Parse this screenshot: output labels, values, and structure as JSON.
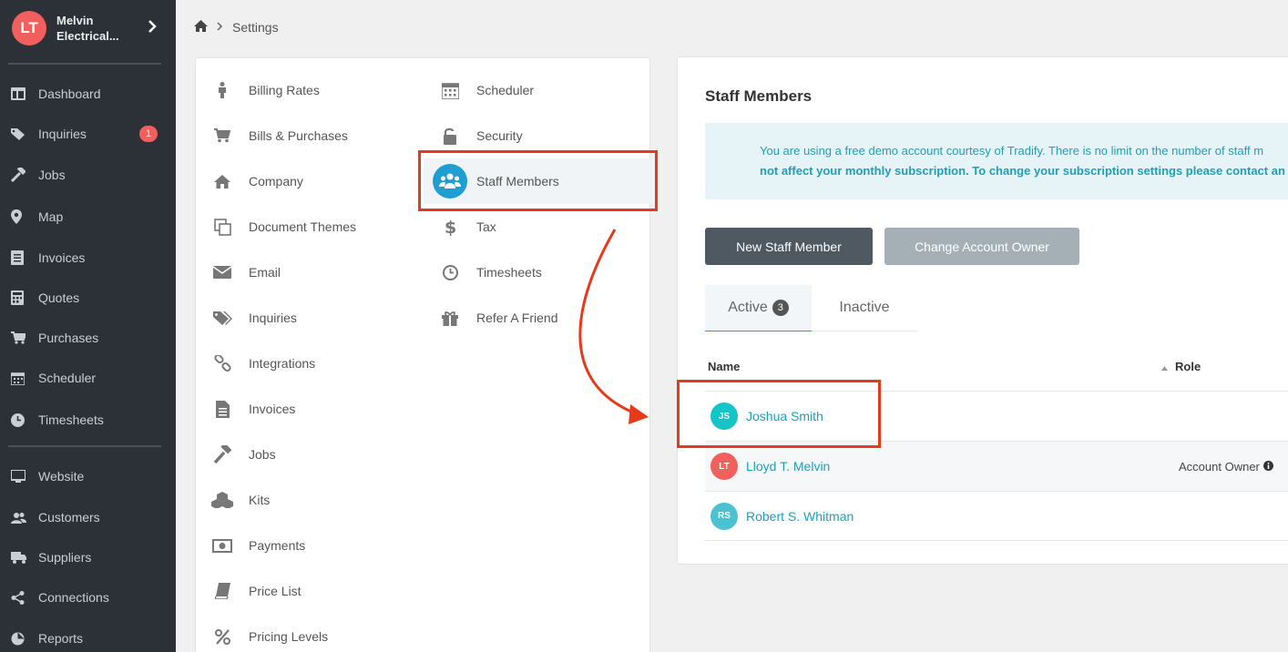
{
  "company": {
    "initials": "LT",
    "name": "Melvin\nElectrical..."
  },
  "sidebar": {
    "items": [
      {
        "label": "Dashboard",
        "icon": "dashboard-icon"
      },
      {
        "label": "Inquiries",
        "icon": "tags-icon",
        "badge": "1"
      },
      {
        "label": "Jobs",
        "icon": "hammer-icon"
      },
      {
        "label": "Map",
        "icon": "map-pin-icon"
      },
      {
        "label": "Invoices",
        "icon": "invoice-icon"
      },
      {
        "label": "Quotes",
        "icon": "calculator-icon"
      },
      {
        "label": "Purchases",
        "icon": "cart-icon"
      },
      {
        "label": "Scheduler",
        "icon": "calendar-icon"
      },
      {
        "label": "Timesheets",
        "icon": "clock-icon"
      },
      {
        "label": "Website",
        "icon": "monitor-icon"
      },
      {
        "label": "Customers",
        "icon": "users-icon"
      },
      {
        "label": "Suppliers",
        "icon": "truck-icon"
      },
      {
        "label": "Connections",
        "icon": "share-icon"
      },
      {
        "label": "Reports",
        "icon": "reports-icon"
      }
    ]
  },
  "breadcrumb": {
    "current": "Settings"
  },
  "settings": {
    "col1": [
      "Billing Rates",
      "Bills & Purchases",
      "Company",
      "Document Themes",
      "Email",
      "Inquiries",
      "Integrations",
      "Invoices",
      "Jobs",
      "Kits",
      "Payments",
      "Price List",
      "Pricing Levels"
    ],
    "col2": [
      "Scheduler",
      "Security",
      "Staff Members",
      "Tax",
      "Timesheets",
      "Refer A Friend"
    ]
  },
  "staff": {
    "title": "Staff Members",
    "notice_line1": "You are using a free demo account courtesy of Tradify. There is no limit on the number of staff m",
    "notice_line2": "not affect your monthly subscription. To change your subscription settings please contact an",
    "new_button": "New Staff Member",
    "change_owner_button": "Change Account Owner",
    "tabs": {
      "active": "Active",
      "active_count": "3",
      "inactive": "Inactive"
    },
    "columns": {
      "name": "Name",
      "role": "Role"
    },
    "rows": [
      {
        "initials": "JS",
        "name": "Joshua Smith",
        "role": "",
        "color": "#16c3c7"
      },
      {
        "initials": "LT",
        "name": "Lloyd T. Melvin",
        "role": "Account Owner",
        "color": "#f2605e"
      },
      {
        "initials": "RS",
        "name": "Robert S. Whitman",
        "role": "",
        "color": "#4cc1d1"
      }
    ]
  },
  "colors": {
    "sidebar": "#2b3136",
    "accent": "#1f9fd1",
    "highlight": "#e63a1b"
  }
}
